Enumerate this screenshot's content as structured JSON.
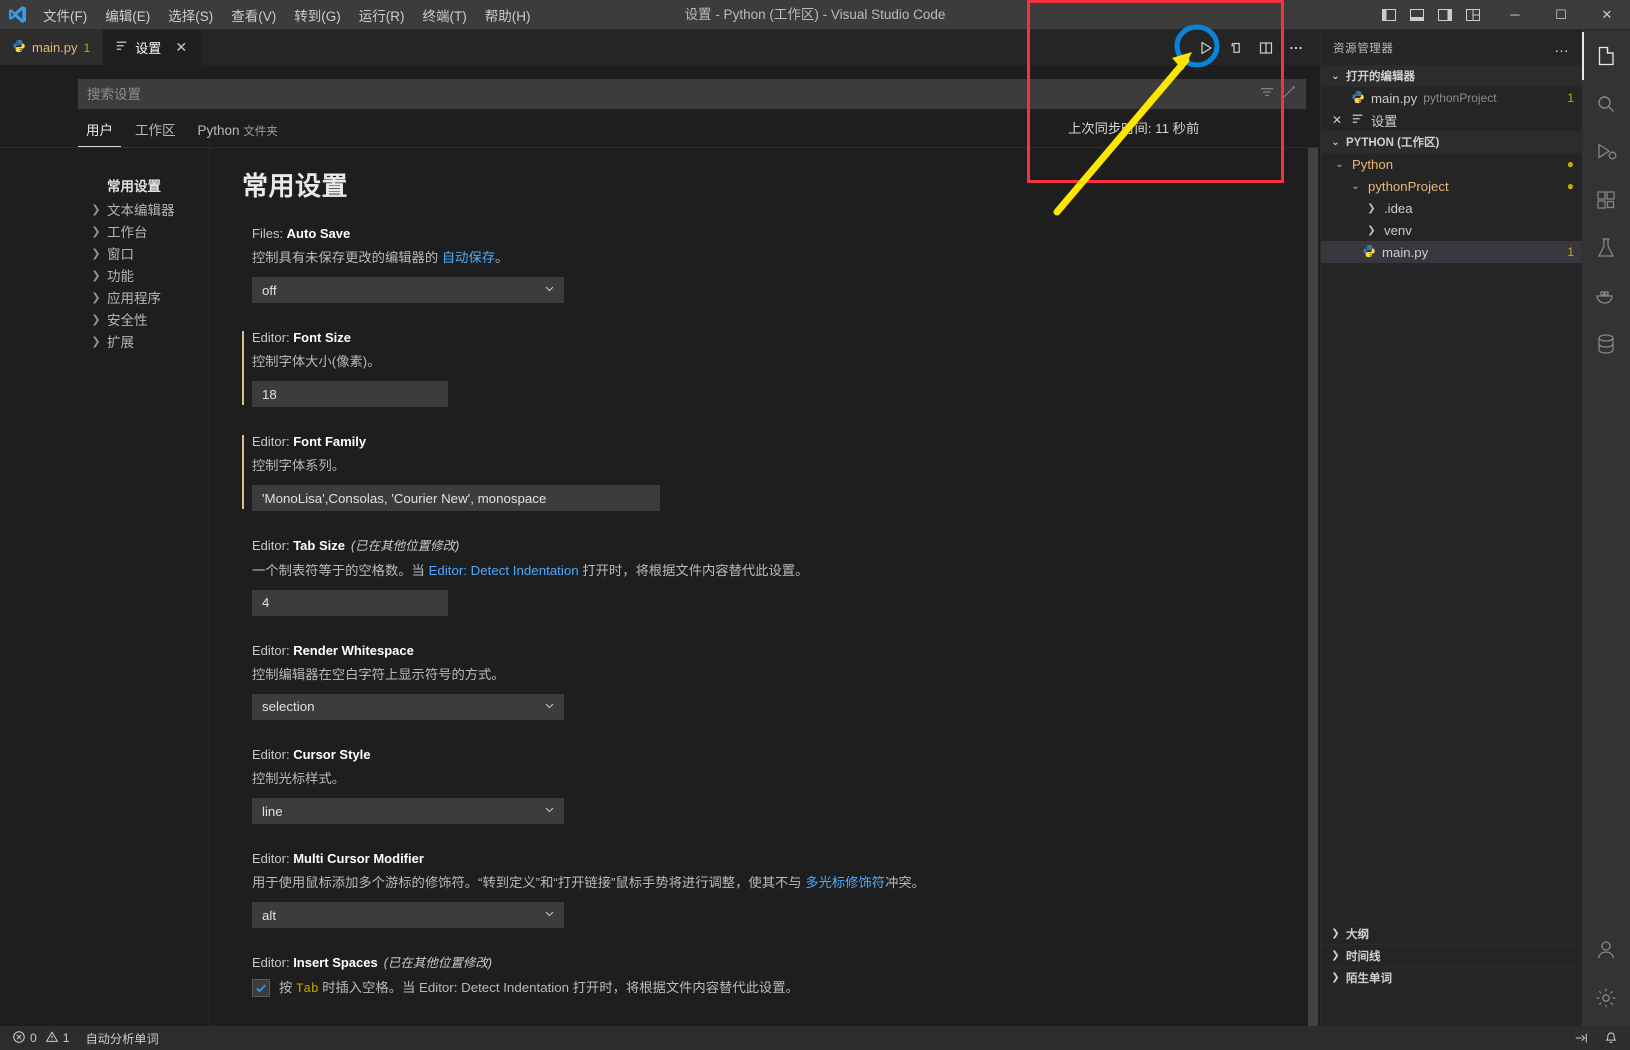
{
  "window": {
    "title": "设置 - Python (工作区) - Visual Studio Code",
    "menus": [
      "文件(F)",
      "编辑(E)",
      "选择(S)",
      "查看(V)",
      "转到(G)",
      "运行(R)",
      "终端(T)",
      "帮助(H)"
    ],
    "controls": {
      "minimize": "─",
      "maximize": "☐",
      "close": "✕"
    }
  },
  "tabs": [
    {
      "name": "main.py",
      "badge": "1",
      "icon": "python-icon",
      "active": false
    },
    {
      "name": "设置",
      "badge": "",
      "icon": "settings-icon",
      "active": true
    }
  ],
  "editor_actions": {
    "run_label": "运行 Python 文件",
    "open_changes_label": "打开更改",
    "split_label": "拆分编辑器",
    "more_label": "更多操作..."
  },
  "tooltip": {
    "sync_text": "上次同步时间: 11 秒前"
  },
  "settings": {
    "search": {
      "placeholder": "搜索设置",
      "value": ""
    },
    "scope_tabs": [
      {
        "label": "用户",
        "sub": "",
        "active": true
      },
      {
        "label": "工作区",
        "sub": "",
        "active": false
      },
      {
        "label": "Python",
        "sub": "文件夹",
        "active": false
      }
    ],
    "toc": [
      {
        "label": "常用设置",
        "expandable": false,
        "head": true
      },
      {
        "label": "文本编辑器",
        "expandable": true,
        "head": false
      },
      {
        "label": "工作台",
        "expandable": true,
        "head": false
      },
      {
        "label": "窗口",
        "expandable": true,
        "head": false
      },
      {
        "label": "功能",
        "expandable": true,
        "head": false
      },
      {
        "label": "应用程序",
        "expandable": true,
        "head": false
      },
      {
        "label": "安全性",
        "expandable": true,
        "head": false
      },
      {
        "label": "扩展",
        "expandable": true,
        "head": false
      }
    ],
    "page_title": "常用设置",
    "modified_note": "(已在其他位置修改)",
    "items": [
      {
        "prefix": "Files: ",
        "key": "Auto Save",
        "modified": false,
        "modified_note": "",
        "desc_parts": [
          {
            "t": "控制具有未保存更改的编辑器的 ",
            "link": false
          },
          {
            "t": "自动保存",
            "link": true
          },
          {
            "t": "。",
            "link": false
          }
        ],
        "control": "select",
        "value": "off"
      },
      {
        "prefix": "Editor: ",
        "key": "Font Size",
        "modified": true,
        "modified_note": "",
        "desc_parts": [
          {
            "t": "控制字体大小(像素)。",
            "link": false
          }
        ],
        "control": "text",
        "value": "18"
      },
      {
        "prefix": "Editor: ",
        "key": "Font Family",
        "modified": true,
        "modified_note": "",
        "desc_parts": [
          {
            "t": "控制字体系列。",
            "link": false
          }
        ],
        "control": "text-wide",
        "value": "'MonoLisa',Consolas, 'Courier New', monospace"
      },
      {
        "prefix": "Editor: ",
        "key": "Tab Size",
        "modified": false,
        "modified_note": "(已在其他位置修改)",
        "desc_parts": [
          {
            "t": "一个制表符等于的空格数。当 ",
            "link": false
          },
          {
            "t": "Editor: Detect Indentation",
            "link": true
          },
          {
            "t": " 打开时，将根据文件内容替代此设置。",
            "link": false
          }
        ],
        "control": "text",
        "value": "4"
      },
      {
        "prefix": "Editor: ",
        "key": "Render Whitespace",
        "modified": false,
        "modified_note": "",
        "desc_parts": [
          {
            "t": "控制编辑器在空白字符上显示符号的方式。",
            "link": false
          }
        ],
        "control": "select",
        "value": "selection"
      },
      {
        "prefix": "Editor: ",
        "key": "Cursor Style",
        "modified": false,
        "modified_note": "",
        "desc_parts": [
          {
            "t": "控制光标样式。",
            "link": false
          }
        ],
        "control": "select",
        "value": "line"
      },
      {
        "prefix": "Editor: ",
        "key": "Multi Cursor Modifier",
        "modified": false,
        "modified_note": "",
        "desc_parts": [
          {
            "t": "用于使用鼠标添加多个游标的修饰符。“转到定义”和“打开链接”鼠标手势将进行调整，使其不与 ",
            "link": false
          },
          {
            "t": "多光标修饰符",
            "link": true
          },
          {
            "t": "冲突。",
            "link": false
          }
        ],
        "control": "select",
        "value": "alt"
      },
      {
        "prefix": "Editor: ",
        "key": "Insert Spaces",
        "modified": false,
        "modified_note": "(已在其他位置修改)",
        "desc_parts": [],
        "control": "checkbox",
        "checked": true,
        "checkbox_parts": [
          {
            "t": "按 ",
            "link": false,
            "code": false
          },
          {
            "t": "Tab",
            "link": false,
            "code": true
          },
          {
            "t": " 时插入空格。当 ",
            "link": false,
            "code": false
          },
          {
            "t": "Editor: Detect Indentation",
            "link": true,
            "code": false
          },
          {
            "t": " 打开时，将根据文件内容替代此设置。",
            "link": false,
            "code": false
          }
        ]
      }
    ]
  },
  "explorer": {
    "title": "资源管理器",
    "more_label": "…",
    "sections": [
      {
        "label": "打开的编辑器",
        "expanded": true
      },
      {
        "label": "PYTHON (工作区)",
        "expanded": true
      }
    ],
    "open_editors": [
      {
        "label": "main.py",
        "sub": "pythonProject",
        "icon": "python-icon",
        "count": "1",
        "selected": false,
        "close": false
      },
      {
        "label": "设置",
        "sub": "",
        "icon": "settings-icon",
        "count": "",
        "selected": false,
        "close": true
      }
    ],
    "tree": [
      {
        "label": "Python",
        "type": "folder",
        "expanded": true,
        "depth": 0,
        "dot": true,
        "selected": false
      },
      {
        "label": "pythonProject",
        "type": "folder",
        "expanded": true,
        "depth": 1,
        "dot": true,
        "selected": false
      },
      {
        "label": ".idea",
        "type": "folder",
        "expanded": false,
        "depth": 2,
        "dot": false,
        "selected": false
      },
      {
        "label": "venv",
        "type": "folder",
        "expanded": false,
        "depth": 2,
        "dot": false,
        "selected": false
      },
      {
        "label": "main.py",
        "type": "file",
        "expanded": false,
        "depth": 2,
        "dot": false,
        "selected": true,
        "count": "1"
      }
    ],
    "collapsed_panels": [
      {
        "label": "大纲"
      },
      {
        "label": "时间线"
      },
      {
        "label": "陌生单词"
      }
    ]
  },
  "activity_bar": {
    "items": [
      {
        "name": "explorer-icon",
        "active": true
      },
      {
        "name": "search-icon",
        "active": false
      },
      {
        "name": "run-debug-icon",
        "active": false
      },
      {
        "name": "extensions-icon",
        "active": false
      },
      {
        "name": "testing-icon",
        "active": false
      },
      {
        "name": "docker-icon",
        "active": false
      },
      {
        "name": "database-icon",
        "active": false
      }
    ],
    "bottom": [
      {
        "name": "account-icon"
      },
      {
        "name": "settings-gear-icon"
      }
    ]
  },
  "statusbar": {
    "errors": "0",
    "warnings": "1",
    "analysis": "自动分析单词",
    "right_items": [
      "notifications-icon"
    ]
  },
  "colors": {
    "accent_blue": "#4daafc",
    "warning_yellow": "#cca700",
    "annotation_red": "#f5333f",
    "annotation_yellow": "#ffe600",
    "annotation_blue": "#0a84d8",
    "folder_orange": "#e8b77a"
  }
}
